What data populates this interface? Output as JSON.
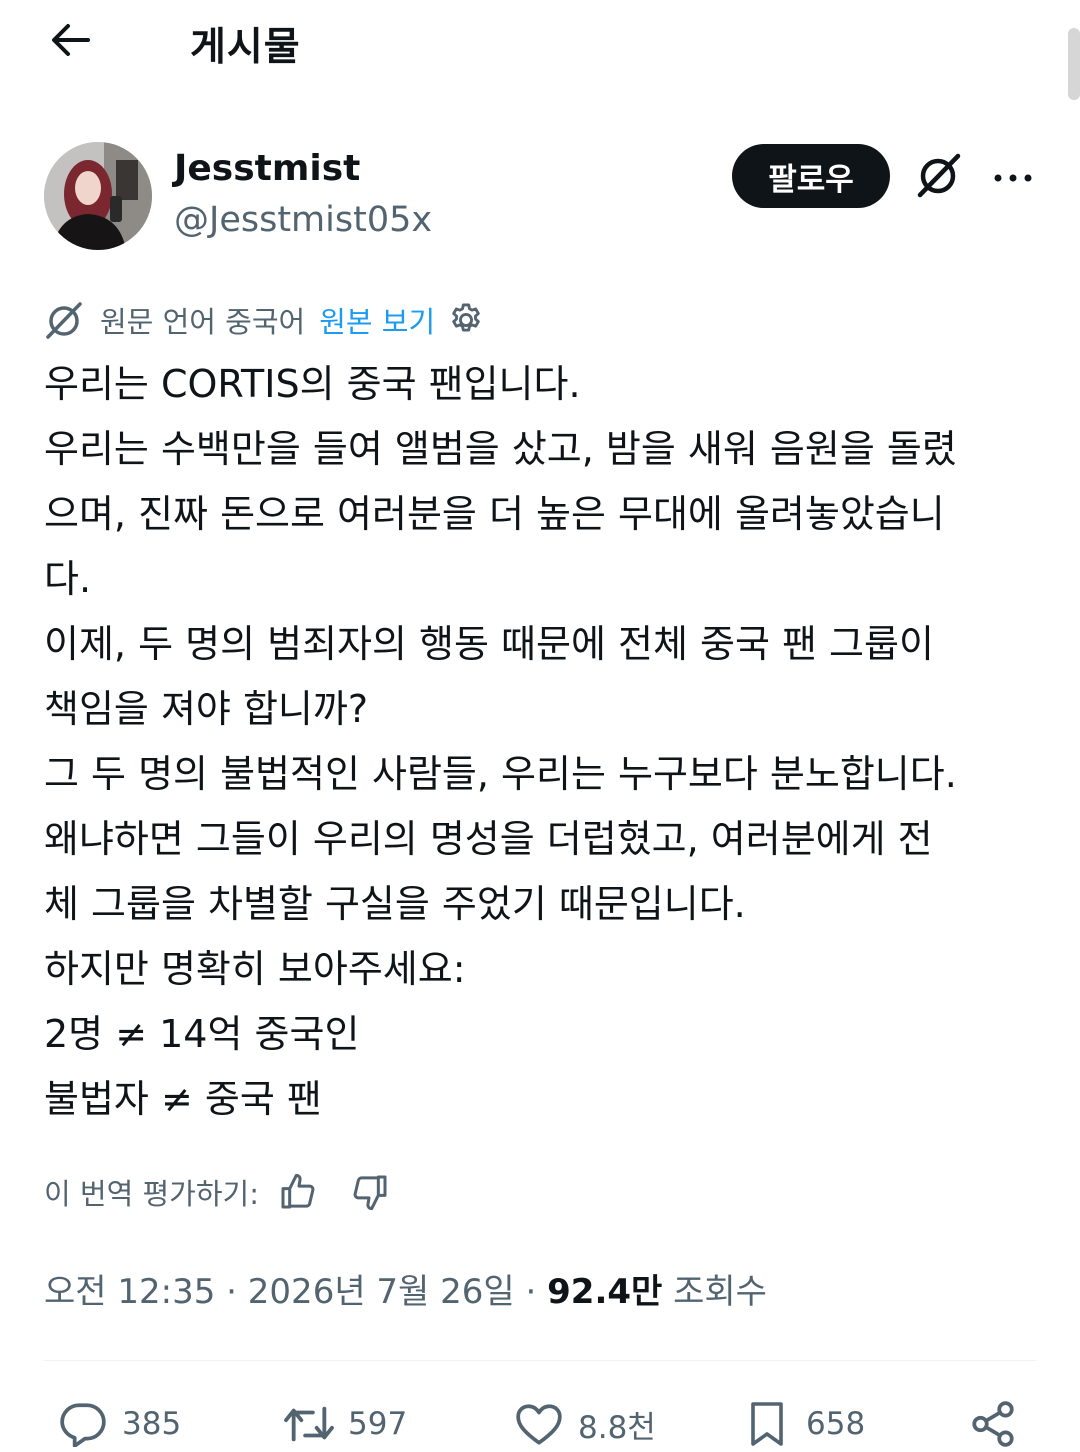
{
  "header": {
    "title": "게시물"
  },
  "author": {
    "display_name": "Jesstmist",
    "handle": "@Jesstmist05x"
  },
  "follow_label": "팔로우",
  "translation": {
    "label": "원문 언어 중국어",
    "show_original": "원본 보기"
  },
  "post_lines": [
    "우리는 CORTIS의 중국 팬입니다.",
    "우리는 수백만을 들여 앨범을 샀고, 밤을 새워 음원을 돌렸",
    "으며, 진짜 돈으로 여러분을 더 높은 무대에 올려놓았습니",
    "다.",
    "이제, 두 명의 범죄자의 행동 때문에 전체 중국 팬 그룹이",
    "책임을 져야 합니까?",
    "그 두 명의 불법적인 사람들, 우리는 누구보다 분노합니다.",
    "왜냐하면 그들이 우리의 명성을 더럽혔고, 여러분에게 전",
    "체 그룹을 차별할 구실을 주었기 때문입니다.",
    "하지만 명확히 보아주세요:",
    "2명 ≠ 14억 중국인",
    "불법자 ≠ 중국 팬"
  ],
  "rate_translation": "이 번역 평가하기:",
  "meta": {
    "time": "오전 12:35",
    "separator": " · ",
    "date": "2026년 7월 26일",
    "views_count": "92.4만",
    "views_label": "조회수"
  },
  "actions": {
    "replies": "385",
    "reposts": "597",
    "likes": "8.8천",
    "bookmarks": "658"
  },
  "icons": {
    "back": "arrow-left-icon",
    "grok": "grok-icon",
    "more": "more-dots-icon",
    "translate": "translate-icon",
    "settings": "gear-icon",
    "thumb_up": "thumbs-up-icon",
    "thumb_down": "thumbs-down-icon",
    "reply": "reply-icon",
    "repost": "repost-icon",
    "like": "heart-icon",
    "bookmark": "bookmark-icon",
    "share": "share-icon"
  },
  "colors": {
    "accent": "#1d9bf0",
    "text": "#0f1419",
    "secondary": "#536471"
  }
}
